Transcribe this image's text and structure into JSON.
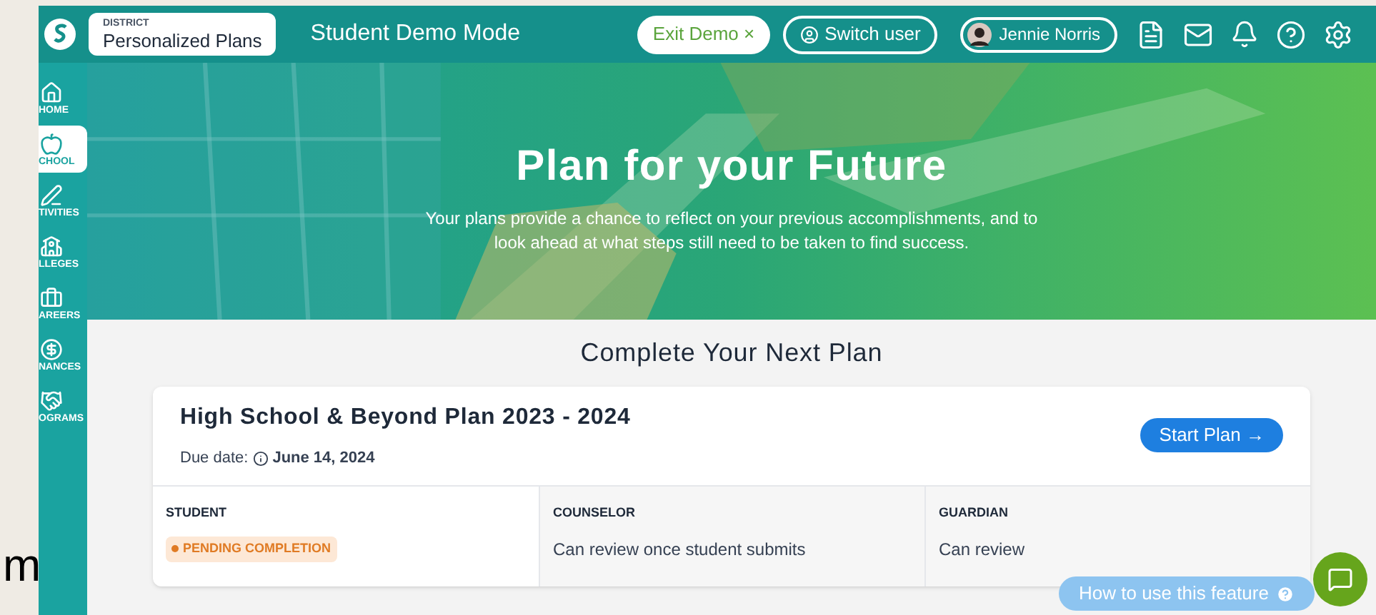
{
  "background_text": "m",
  "topbar": {
    "district_label": "DISTRICT",
    "district_name": "Personalized Plans",
    "mode": "Student Demo Mode",
    "exit_button": "Exit Demo ×",
    "switch_button": "Switch user",
    "user_name": "Jennie Norris"
  },
  "sidebar": {
    "items": [
      {
        "label": "HOME",
        "selected": false
      },
      {
        "label": "CHOOL",
        "selected": true
      },
      {
        "label": "TIVITIES",
        "selected": false
      },
      {
        "label": "LLEGES",
        "selected": false
      },
      {
        "label": "AREERS",
        "selected": false
      },
      {
        "label": "NANCES",
        "selected": false
      },
      {
        "label": "OGRAMS",
        "selected": false
      }
    ]
  },
  "hero": {
    "title": "Plan for your Future",
    "text": "Your plans provide a chance to reflect on your previous accomplishments, and to look ahead at what steps still need to be taken to find success."
  },
  "section_title": "Complete Your Next Plan",
  "plan": {
    "title": "High School & Beyond Plan 2023 - 2024",
    "due_label": "Due date:",
    "due_date": "June 14, 2024",
    "button": "Start Plan →",
    "columns": [
      {
        "heading": "STUDENT",
        "kind": "badge",
        "text": "PENDING COMPLETION"
      },
      {
        "heading": "COUNSELOR",
        "kind": "note",
        "text": "Can review once student submits"
      },
      {
        "heading": "GUARDIAN",
        "kind": "note",
        "text": "Can review"
      }
    ]
  },
  "help_tooltip": "How to use this feature"
}
